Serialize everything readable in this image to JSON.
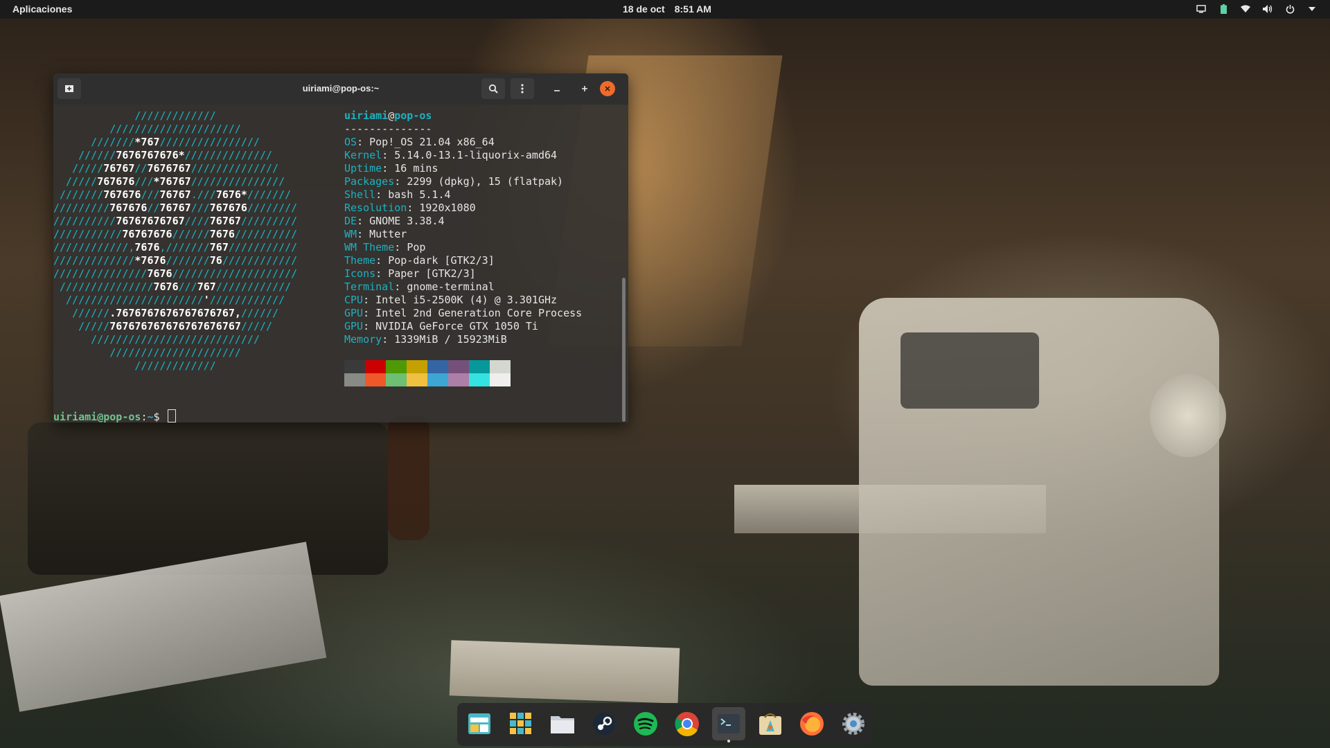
{
  "topbar": {
    "apps_label": "Aplicaciones",
    "date": "18 de oct",
    "time": "8:51 AM",
    "tray_icons": [
      "screen-share-icon",
      "battery-icon",
      "wifi-icon",
      "volume-icon",
      "power-icon",
      "chevron-down-icon"
    ]
  },
  "terminal": {
    "title": "uiriami@pop-os:~",
    "header_user": "uiriami",
    "header_at": "@",
    "header_host": "pop-os",
    "separator": "--------------",
    "info": [
      {
        "key": "OS",
        "value": "Pop!_OS 21.04 x86_64"
      },
      {
        "key": "Kernel",
        "value": "5.14.0-13.1-liquorix-amd64"
      },
      {
        "key": "Uptime",
        "value": "16 mins"
      },
      {
        "key": "Packages",
        "value": "2299 (dpkg), 15 (flatpak)"
      },
      {
        "key": "Shell",
        "value": "bash 5.1.4"
      },
      {
        "key": "Resolution",
        "value": "1920x1080"
      },
      {
        "key": "DE",
        "value": "GNOME 3.38.4"
      },
      {
        "key": "WM",
        "value": "Mutter"
      },
      {
        "key": "WM Theme",
        "value": "Pop"
      },
      {
        "key": "Theme",
        "value": "Pop-dark [GTK2/3]"
      },
      {
        "key": "Icons",
        "value": "Paper [GTK2/3]"
      },
      {
        "key": "Terminal",
        "value": "gnome-terminal"
      },
      {
        "key": "CPU",
        "value": "Intel i5-2500K (4) @ 3.301GHz"
      },
      {
        "key": "GPU",
        "value": "Intel 2nd Generation Core Process"
      },
      {
        "key": "GPU",
        "value": "NVIDIA GeForce GTX 1050 Ti"
      },
      {
        "key": "Memory",
        "value": "1339MiB / 15923MiB"
      }
    ],
    "palette_top": [
      "#3a3a3a",
      "#cc0000",
      "#4e9a06",
      "#c4a000",
      "#3465a4",
      "#75507b",
      "#06989a",
      "#d3d7cf"
    ],
    "palette_bottom": [
      "#888a85",
      "#f0582a",
      "#6cbf73",
      "#f0c040",
      "#3ea6d3",
      "#ad7fa8",
      "#34e2e2",
      "#eeeeec"
    ],
    "prompt_user": "uiriami@pop-os",
    "prompt_sep": ":",
    "prompt_path": "~",
    "prompt_symbol": "$ "
  },
  "dock": {
    "items": [
      {
        "name": "workspaces-icon",
        "active": false
      },
      {
        "name": "app-grid-icon",
        "active": false
      },
      {
        "name": "files-icon",
        "active": false
      },
      {
        "name": "steam-icon",
        "active": false
      },
      {
        "name": "spotify-icon",
        "active": false
      },
      {
        "name": "chrome-icon",
        "active": false
      },
      {
        "name": "terminal-icon",
        "active": true
      },
      {
        "name": "pop-shop-icon",
        "active": false
      },
      {
        "name": "firefox-icon",
        "active": false
      },
      {
        "name": "settings-icon",
        "active": false
      }
    ]
  }
}
